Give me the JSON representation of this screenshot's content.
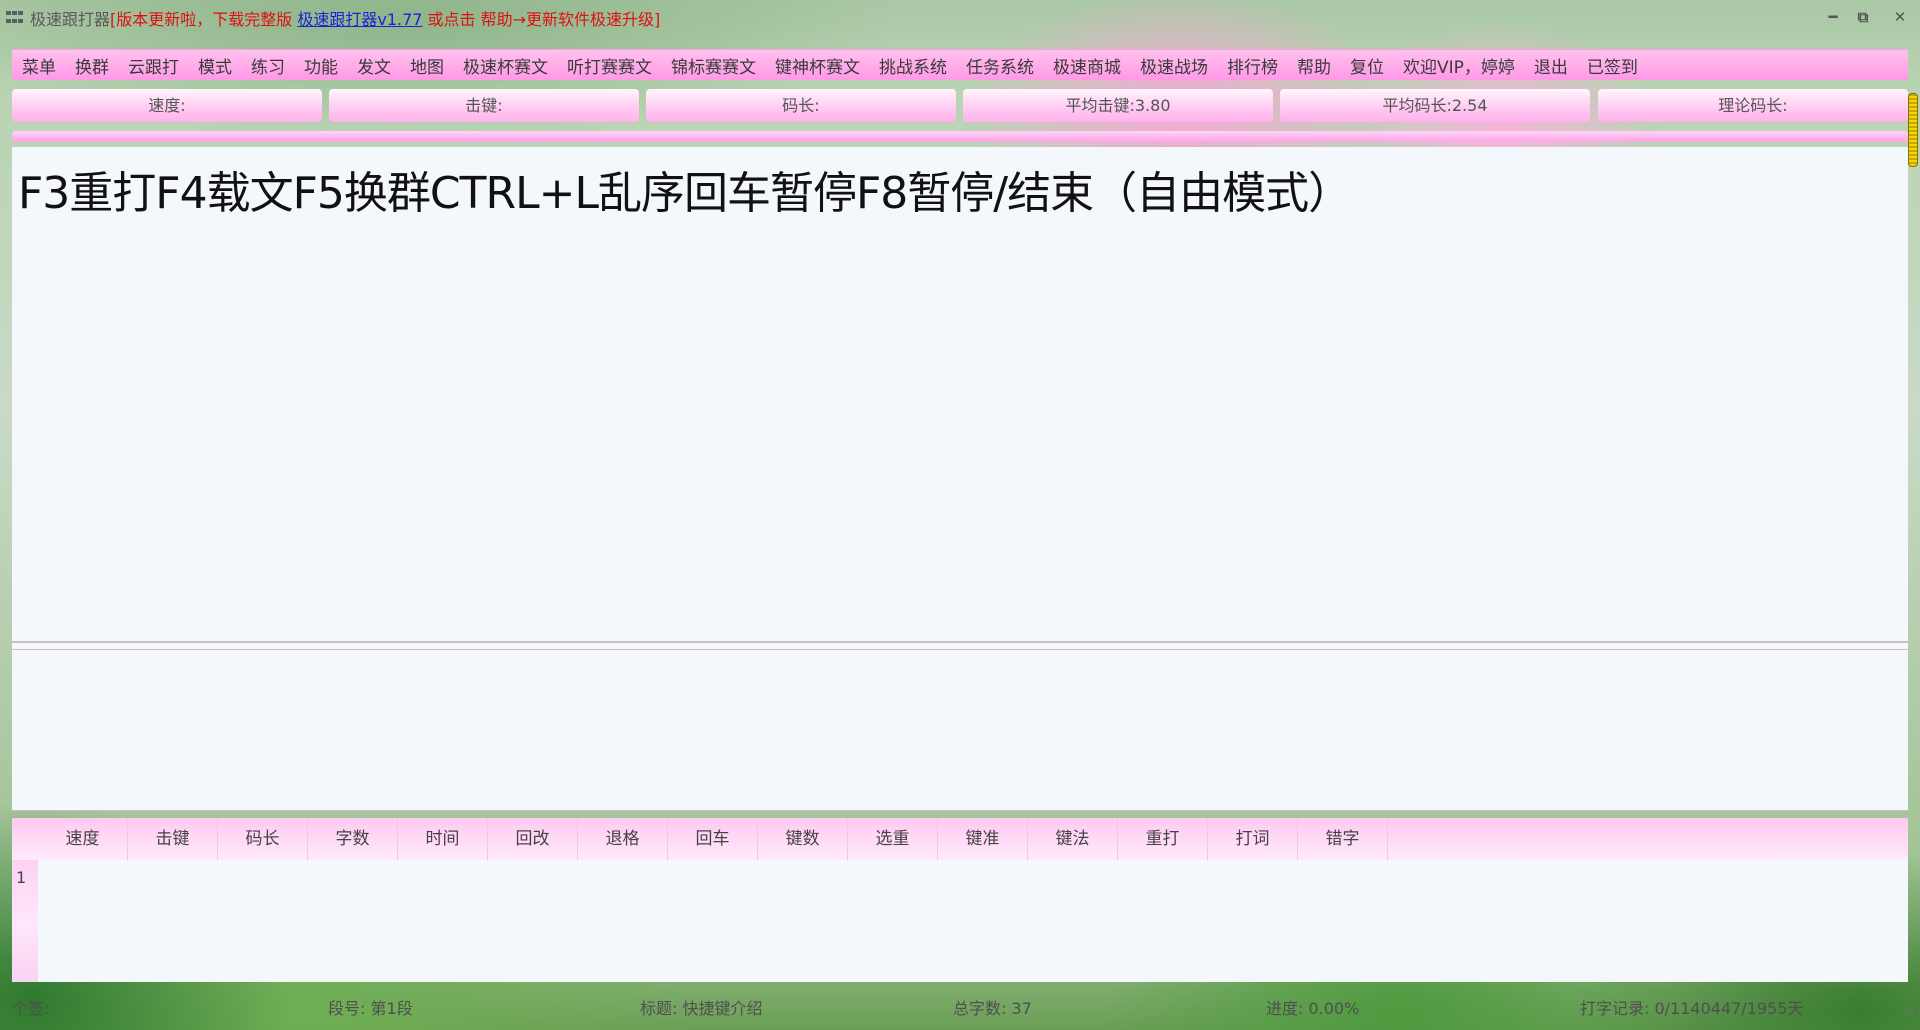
{
  "window": {
    "app_name": "极速跟打器",
    "notice_prefix": "[版本更新啦，下载完整版 ",
    "link_text": "极速跟打器v1.77",
    "notice_suffix": " 或点击 帮助→更新软件极速升级]",
    "min_icon": "minimize-icon",
    "restore_icon": "restore-icon",
    "close_icon": "close-icon"
  },
  "menu": {
    "items": [
      "菜单",
      "换群",
      "云跟打",
      "模式",
      "练习",
      "功能",
      "发文",
      "地图",
      "极速杯赛文",
      "听打赛赛文",
      "锦标赛赛文",
      "键神杯赛文",
      "挑战系统",
      "任务系统",
      "极速商城",
      "极速战场",
      "排行榜",
      "帮助",
      "复位",
      "欢迎VIP，婷婷",
      "退出",
      "已签到"
    ]
  },
  "stats": {
    "speed": "速度:",
    "keystroke": "击键:",
    "code_length": "码长:",
    "avg_keystroke": "平均击键:3.80",
    "avg_code_length": "平均码长:2.54",
    "theory_code_length": "理论码长:"
  },
  "article": {
    "text": "F3重打F4载文F5换群CTRL+L乱序回车暂停F8暂停/结束（自由模式）"
  },
  "results_table": {
    "columns": [
      "速度",
      "击键",
      "码长",
      "字数",
      "时间",
      "回改",
      "退格",
      "回车",
      "键数",
      "选重",
      "键准",
      "键法",
      "重打",
      "打词",
      "错字"
    ],
    "row_numbers": [
      "1"
    ]
  },
  "status": {
    "signature": "个签:",
    "segment": "段号: 第1段",
    "title": "标题: 快捷键介绍",
    "total_chars": "总字数: 37",
    "progress": "进度: 0.00%",
    "record": "打字记录: 0/1140447/1955天"
  }
}
